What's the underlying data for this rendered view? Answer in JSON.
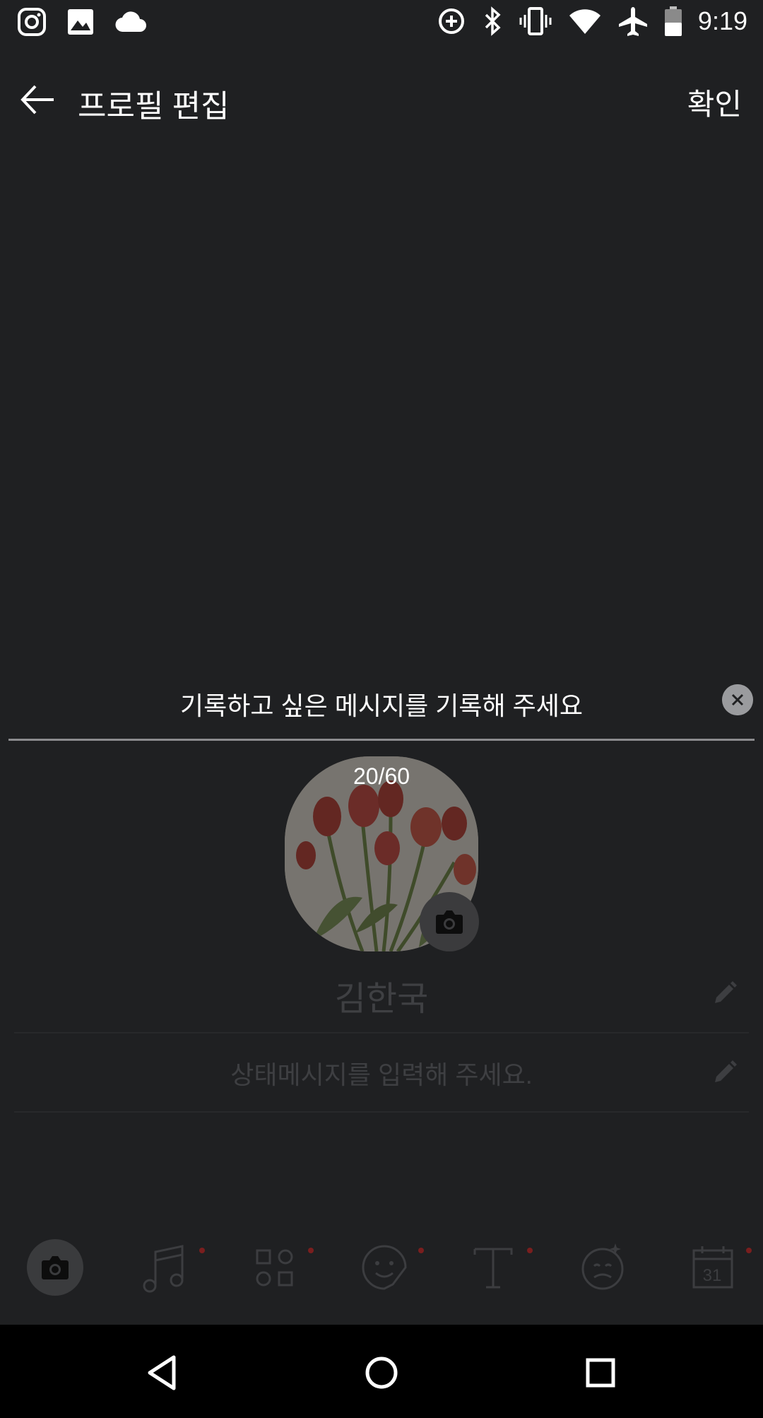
{
  "status_bar": {
    "time": "9:19",
    "left_icons": [
      "instagram-icon",
      "image-icon",
      "cloud-icon"
    ],
    "right_icons": [
      "data-saver-icon",
      "bluetooth-icon",
      "vibrate-icon",
      "wifi-icon",
      "airplane-icon",
      "battery-icon"
    ]
  },
  "toolbar": {
    "title": "프로필 편집",
    "confirm_label": "확인"
  },
  "message_input": {
    "value": "기록하고 싶은 메시지를 기록해 주세요",
    "counter": "20/60"
  },
  "profile": {
    "name": "김한국",
    "status_placeholder": "상태메시지를 입력해 주세요."
  },
  "bottom_tools": [
    "camera-icon",
    "music-icon",
    "grid-icon",
    "sticker-icon",
    "text-icon",
    "emoji-icon",
    "calendar-icon"
  ],
  "calendar_day": "31",
  "colors": {
    "background": "#1f2022",
    "navbar": "#000000",
    "badge_dot": "#7a1e1e"
  }
}
